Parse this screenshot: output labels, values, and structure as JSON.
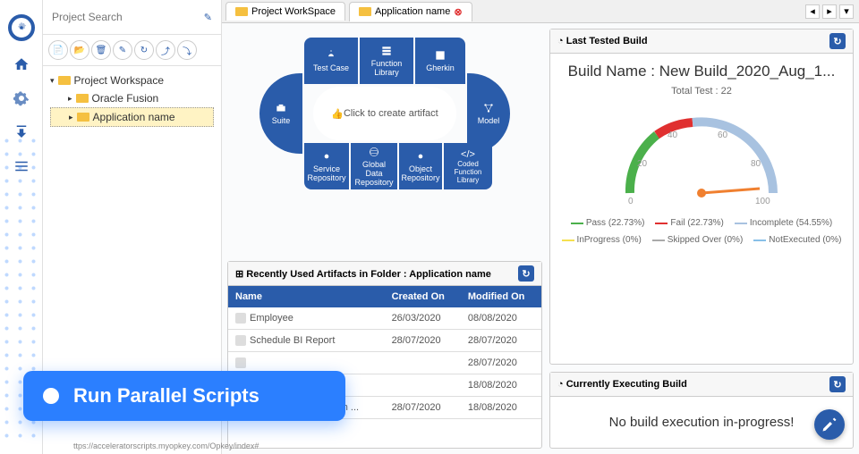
{
  "search": {
    "placeholder": "Project Search"
  },
  "tree": {
    "root": "Project Workspace",
    "items": [
      "Oracle Fusion",
      "Application name"
    ]
  },
  "tabs": [
    "Project WorkSpace",
    "Application name"
  ],
  "wheel": {
    "center": "Click to create artifact",
    "segments": {
      "test_case": "Test Case",
      "function_library": "Function Library",
      "gherkin": "Gherkin",
      "suite": "Suite",
      "model": "Model",
      "service_repo": "Service Repository",
      "global_data": "Global Data Repository",
      "object_repo": "Object Repository",
      "coded_func": "Coded Function Library"
    }
  },
  "artifacts": {
    "header": "Recently Used Artifacts in Folder : Application name",
    "columns": [
      "Name",
      "Created On",
      "Modified On"
    ],
    "rows": [
      {
        "name": "Employee",
        "created": "26/03/2020",
        "modified": "08/08/2020"
      },
      {
        "name": "Schedule BI Report",
        "created": "28/07/2020",
        "modified": "28/07/2020"
      },
      {
        "name": "",
        "created": "",
        "modified": "28/07/2020"
      },
      {
        "name": "",
        "created": "",
        "modified": "18/08/2020"
      },
      {
        "name": "Validate Email through ...",
        "created": "28/07/2020",
        "modified": "18/08/2020"
      }
    ]
  },
  "last_build": {
    "header": "Last Tested Build",
    "title": "Build Name : New Build_2020_Aug_1...",
    "total": "Total Test : 22",
    "ticks": [
      "0",
      "20",
      "40",
      "60",
      "80",
      "100"
    ],
    "legend": [
      {
        "label": "Pass (22.73%)",
        "color": "#4bb04b"
      },
      {
        "label": "Fail (22.73%)",
        "color": "#e03030"
      },
      {
        "label": "Incomplete (54.55%)",
        "color": "#a8c2e0"
      },
      {
        "label": "InProgress (0%)",
        "color": "#f5e050"
      },
      {
        "label": "Skipped Over (0%)",
        "color": "#aaa"
      },
      {
        "label": "NotExecuted (0%)",
        "color": "#88c0e8"
      }
    ]
  },
  "exec_build": {
    "header": "Currently Executing Build",
    "message": "No build execution in-progress!"
  },
  "banner": "Run Parallel Scripts",
  "footer_url": "ttps://acceleratorscripts.myopkey.com/Opkey/index#",
  "chart_data": {
    "type": "pie",
    "title": "Last Tested Build",
    "series": [
      {
        "name": "Pass",
        "value": 22.73,
        "color": "#4bb04b"
      },
      {
        "name": "Fail",
        "value": 22.73,
        "color": "#e03030"
      },
      {
        "name": "Incomplete",
        "value": 54.55,
        "color": "#a8c2e0"
      },
      {
        "name": "InProgress",
        "value": 0,
        "color": "#f5e050"
      },
      {
        "name": "Skipped Over",
        "value": 0,
        "color": "#aaa"
      },
      {
        "name": "NotExecuted",
        "value": 0,
        "color": "#88c0e8"
      }
    ],
    "total_tests": 22,
    "gauge_range": [
      0,
      100
    ],
    "gauge_needle": 100
  }
}
